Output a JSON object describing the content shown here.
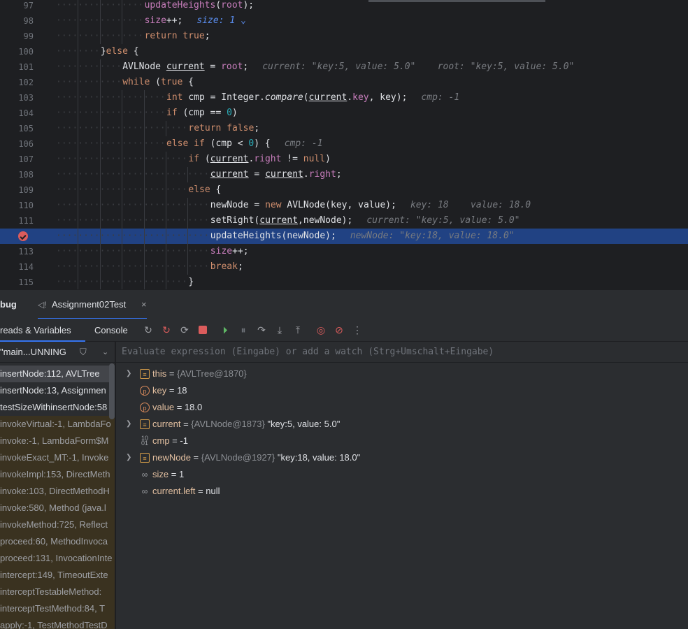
{
  "editor": {
    "lines": [
      {
        "no": "97",
        "indent": 4,
        "segs": [
          [
            "fn",
            "updateHeights"
          ],
          [
            "",
            "("
          ],
          [
            "fld",
            "root"
          ],
          [
            "",
            ");"
          ]
        ]
      },
      {
        "no": "98",
        "indent": 4,
        "segs": [
          [
            "fld",
            "size"
          ],
          [
            "",
            "++;"
          ]
        ],
        "hint": "size: 1",
        "hintClass": "hintb",
        "hintSuffix": " ⌄"
      },
      {
        "no": "99",
        "indent": 4,
        "segs": [
          [
            "kw",
            "return "
          ],
          [
            "kw",
            "true"
          ],
          [
            "",
            ";"
          ]
        ]
      },
      {
        "no": "100",
        "indent": 2,
        "segs": [
          [
            "",
            "}"
          ],
          [
            "kw",
            "else"
          ],
          [
            "",
            " {"
          ]
        ]
      },
      {
        "no": "101",
        "indent": 3,
        "segs": [
          [
            "",
            "AVLNode "
          ],
          [
            "ul",
            "current"
          ],
          [
            "",
            " = "
          ],
          [
            "fld",
            "root"
          ],
          [
            "",
            ";"
          ]
        ],
        "hint": "current: \"key:5, value: 5.0\"    root: \"key:5, value: 5.0\""
      },
      {
        "no": "102",
        "indent": 3,
        "segs": [
          [
            "kw",
            "while "
          ],
          [
            "",
            "("
          ],
          [
            "kw",
            "true"
          ],
          [
            "",
            " {"
          ]
        ],
        "fix": "while (true) {"
      },
      {
        "no": "103",
        "indent": 5,
        "segs": [
          [
            "kw",
            "int "
          ],
          [
            "",
            "cmp = Integer."
          ],
          [
            "it",
            "compare"
          ],
          [
            "",
            "("
          ],
          [
            "ul",
            "current"
          ],
          [
            "",
            "."
          ],
          [
            "fld",
            "key"
          ],
          [
            "",
            ", key);"
          ]
        ],
        "hint": "cmp: -1"
      },
      {
        "no": "104",
        "indent": 5,
        "segs": [
          [
            "kw",
            "if "
          ],
          [
            "",
            "(cmp == "
          ],
          [
            "num",
            "0"
          ],
          [
            "",
            ")"
          ]
        ]
      },
      {
        "no": "105",
        "indent": 6,
        "segs": [
          [
            "kw",
            "return "
          ],
          [
            "kw",
            "false"
          ],
          [
            "",
            ";"
          ]
        ]
      },
      {
        "no": "106",
        "indent": 5,
        "segs": [
          [
            "kw",
            "else if "
          ],
          [
            "",
            "(cmp < "
          ],
          [
            "num",
            "0"
          ],
          [
            "",
            ") {"
          ]
        ],
        "hint": "cmp: -1"
      },
      {
        "no": "107",
        "indent": 6,
        "segs": [
          [
            "kw",
            "if "
          ],
          [
            "",
            "("
          ],
          [
            "ul",
            "current"
          ],
          [
            "",
            "."
          ],
          [
            "fld",
            "right"
          ],
          [
            "",
            " != "
          ],
          [
            "kw",
            "null"
          ],
          [
            "",
            ")"
          ]
        ]
      },
      {
        "no": "108",
        "indent": 7,
        "segs": [
          [
            "ul",
            "current"
          ],
          [
            "",
            " = "
          ],
          [
            "ul",
            "current"
          ],
          [
            "",
            "."
          ],
          [
            "fld",
            "right"
          ],
          [
            "",
            ";"
          ]
        ]
      },
      {
        "no": "109",
        "indent": 6,
        "segs": [
          [
            "kw",
            "else "
          ],
          [
            "",
            "{"
          ]
        ]
      },
      {
        "no": "110",
        "indent": 7,
        "segs": [
          [
            "",
            "newNode = "
          ],
          [
            "kw",
            "new "
          ],
          [
            "",
            "AVLNode(key, value);"
          ]
        ],
        "hint": "key: 18    value: 18.0"
      },
      {
        "no": "111",
        "indent": 7,
        "segs": [
          [
            "",
            "setRight("
          ],
          [
            "ul",
            "current"
          ],
          [
            "",
            ",newNode);"
          ]
        ],
        "hint": "current: \"key:5, value: 5.0\""
      },
      {
        "no": "",
        "indent": 7,
        "segs": [
          [
            "",
            "updateHeights(newNode);"
          ]
        ],
        "hint": "newNode: \"key:18, value: 18.0\"",
        "current": true,
        "bp": true
      },
      {
        "no": "113",
        "indent": 7,
        "segs": [
          [
            "fld",
            "size"
          ],
          [
            "",
            "++;"
          ]
        ]
      },
      {
        "no": "114",
        "indent": 7,
        "segs": [
          [
            "kw",
            "break"
          ],
          [
            "",
            ";"
          ]
        ]
      },
      {
        "no": "115",
        "indent": 6,
        "segs": [
          [
            "",
            "}"
          ]
        ]
      }
    ]
  },
  "tabs": {
    "debug": "bug",
    "config": "Assignment02Test",
    "close": "×"
  },
  "toolbar": {
    "threads": "reads & Variables",
    "console": "Console"
  },
  "thread": {
    "label": "\"main...UNNING"
  },
  "frames": [
    {
      "t": "insertNode:112, AVLTree",
      "sel": true
    },
    {
      "t": "insertNode:13, Assignmen"
    },
    {
      "t": "testSizeWithinsertNode:58"
    },
    {
      "t": "invokeVirtual:-1, LambdaFo",
      "lib": true
    },
    {
      "t": "invoke:-1, LambdaForm$M",
      "lib": true
    },
    {
      "t": "invokeExact_MT:-1, Invoke",
      "lib": true
    },
    {
      "t": "invokeImpl:153, DirectMeth",
      "lib": true
    },
    {
      "t": "invoke:103, DirectMethodH",
      "lib": true
    },
    {
      "t": "invoke:580, Method (java.l",
      "lib": true
    },
    {
      "t": "invokeMethod:725, Reflect",
      "lib": true
    },
    {
      "t": "proceed:60, MethodInvoca",
      "lib": true
    },
    {
      "t": "proceed:131, InvocationInte",
      "lib": true
    },
    {
      "t": "intercept:149, TimeoutExte",
      "lib": true
    },
    {
      "t": "interceptTestableMethod:",
      "lib": true
    },
    {
      "t": "interceptTestMethod:84, T",
      "lib": true
    },
    {
      "t": "apply:-1, TestMethodTestD",
      "lib": true
    }
  ],
  "eval": {
    "placeholder": "Evaluate expression (Eingabe) or add a watch (Strg+Umschalt+Eingabe)"
  },
  "variables": [
    {
      "name": "this",
      "type": "{AVLTree@1870}",
      "value": "",
      "icon": "field",
      "exp": true
    },
    {
      "name": "key",
      "type": "",
      "value": "18",
      "icon": "param"
    },
    {
      "name": "value",
      "type": "",
      "value": "18.0",
      "icon": "param"
    },
    {
      "name": "current",
      "type": "{AVLNode@1873}",
      "value": " \"key:5, value: 5.0\"",
      "icon": "field",
      "exp": true
    },
    {
      "name": "cmp",
      "type": "",
      "value": "-1",
      "icon": "prim"
    },
    {
      "name": "newNode",
      "type": "{AVLNode@1927}",
      "value": " \"key:18, value: 18.0\"",
      "icon": "field",
      "exp": true
    },
    {
      "name": "size",
      "type": "",
      "value": "1",
      "icon": "watch"
    },
    {
      "name": "current.left",
      "type": "",
      "value": "null",
      "icon": "watch"
    }
  ]
}
